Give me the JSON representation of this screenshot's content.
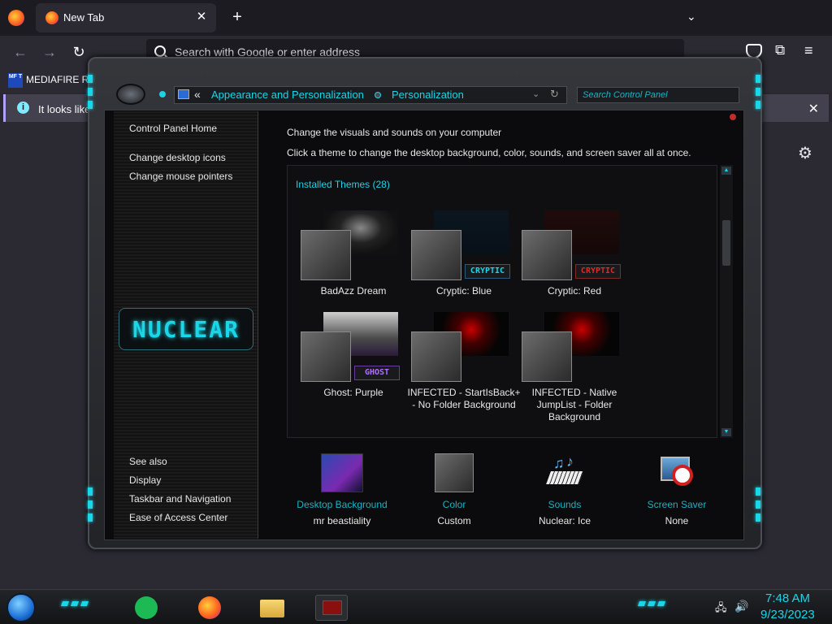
{
  "browser": {
    "tab_title": "New Tab",
    "tab_close": "✕",
    "new_tab": "+",
    "tab_list": "⌄",
    "back": "←",
    "forward": "→",
    "reload": "↻",
    "url_placeholder": "Search with Google or enter address",
    "bookmark_icon_text": "MF T",
    "bookmark_label": "MEDIAFIRE RO",
    "notice_text": "It looks like",
    "notice_close": "✕",
    "extensions": "⧉",
    "menu": "≡",
    "settings": "⚙"
  },
  "control_panel": {
    "address_chevron": "«",
    "breadcrumb": [
      "Appearance and Personalization",
      "Personalization"
    ],
    "address_dropdown": "⌄",
    "address_refresh": "↻",
    "search_placeholder": "Search Control Panel",
    "sidebar": {
      "home": "Control Panel Home",
      "links": [
        "Change desktop icons",
        "Change mouse pointers"
      ],
      "logo_text": "NUCLEAR",
      "see_also_title": "See also",
      "see_also": [
        "Display",
        "Taskbar and Navigation",
        "Ease of Access Center"
      ]
    },
    "heading": "Change the visuals and sounds on your computer",
    "subheading": "Click a theme to change the desktop background, color, sounds, and screen saver all at once.",
    "installed_themes": "Installed Themes (28)",
    "themes": [
      {
        "name": "BadAzz Dream",
        "tag": ""
      },
      {
        "name": "Cryptic: Blue",
        "tag": "CRYPTIC"
      },
      {
        "name": "Cryptic: Red",
        "tag": "CRYPTIC"
      },
      {
        "name": "Ghost: Purple",
        "tag": "GHOST"
      },
      {
        "name": "INFECTED - StartIsBack+ - No Folder Background",
        "tag": ""
      },
      {
        "name": "INFECTED - Native JumpList - Folder Background",
        "tag": ""
      }
    ],
    "scroll_up": "▲",
    "scroll_down": "▼",
    "bottom": [
      {
        "label": "Desktop Background",
        "value": "mr beastiality"
      },
      {
        "label": "Color",
        "value": "Custom"
      },
      {
        "label": "Sounds",
        "value": "Nuclear: Ice"
      },
      {
        "label": "Screen Saver",
        "value": "None"
      }
    ]
  },
  "taskbar": {
    "time": "7:48 AM",
    "date": "9/23/2023",
    "net_icon": "🖧",
    "vol_icon": "🔊"
  },
  "colors": {
    "accent": "#19d6e8"
  }
}
